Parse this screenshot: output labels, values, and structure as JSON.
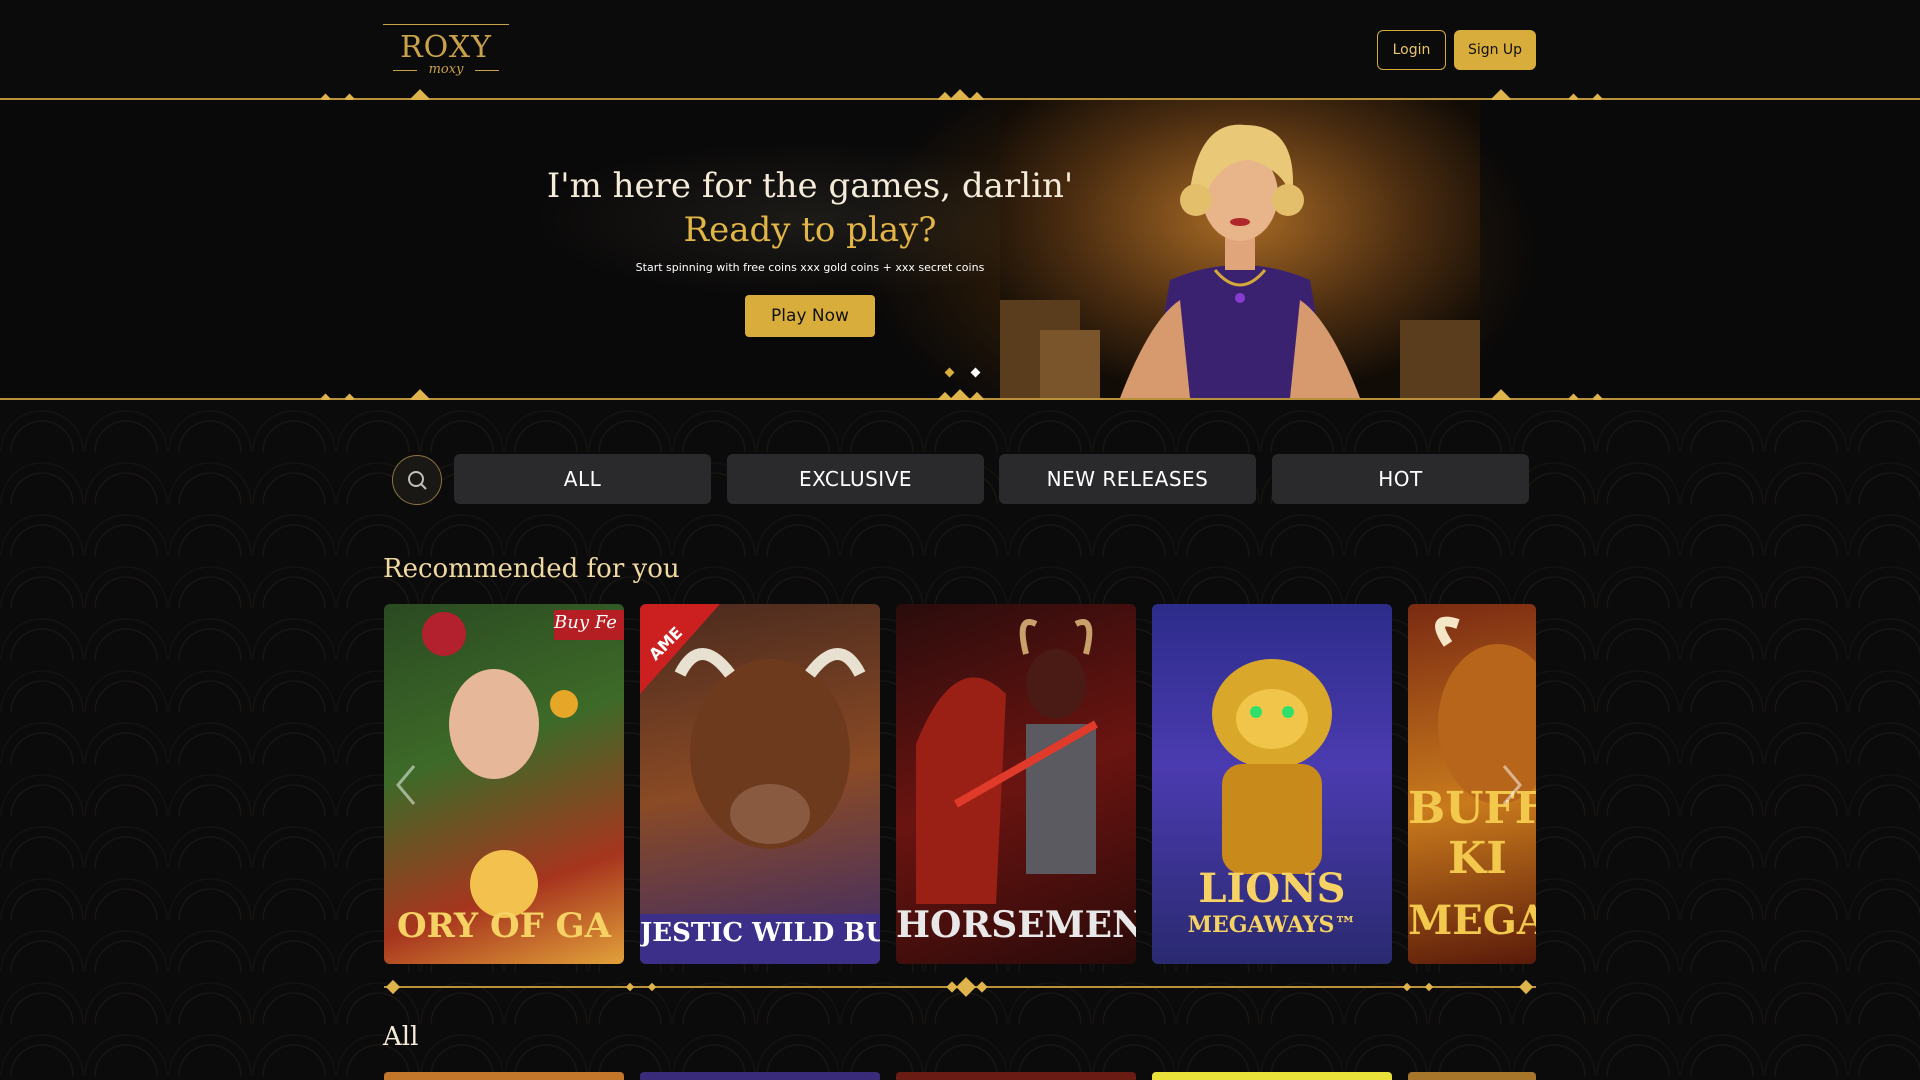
{
  "brand": {
    "name": "ROXY",
    "tagline": "moxy"
  },
  "header": {
    "login_label": "Login",
    "signup_label": "Sign Up"
  },
  "hero": {
    "title": "I'm here for the games, darlin'",
    "subtitle": "Ready to play?",
    "description": "Start spinning with free coins xxx gold coins + xxx secret coins",
    "cta_label": "Play Now",
    "slides_total": 2,
    "active_slide": 2
  },
  "filters": {
    "search_icon": "search-icon",
    "tabs": [
      {
        "label": "ALL"
      },
      {
        "label": "EXCLUSIVE"
      },
      {
        "label": "NEW RELEASES"
      },
      {
        "label": "HOT"
      }
    ]
  },
  "recommended": {
    "title": "Recommended for you",
    "games": [
      {
        "label": "ORY OF GA",
        "badge": "Buy Fe",
        "colors": [
          "#2a4a22",
          "#a7351e",
          "#e2a13a"
        ]
      },
      {
        "label": "JESTIC WILD BUFFA",
        "badge": "AME",
        "colors": [
          "#5a2a18",
          "#9a5530",
          "#3a3a8a"
        ]
      },
      {
        "label": "HORSEMEN I",
        "colors": [
          "#3a0d0d",
          "#8a1c16",
          "#c0392b"
        ]
      },
      {
        "label": "LIONS",
        "sublabel": "MEGAWAYS™",
        "colors": [
          "#2a2a8a",
          "#4b3bb0",
          "#d9a72a"
        ]
      },
      {
        "label": "BUFF",
        "sublabel": "KI",
        "sublabel2": "MEGA",
        "colors": [
          "#7a2a12",
          "#c97a1c",
          "#f2c94c"
        ]
      }
    ]
  },
  "all_section": {
    "title": "All"
  },
  "colors": {
    "gold": "#d9ad3c",
    "gold_line": "#b8913a",
    "bg": "#0b0b0c",
    "tab_bg": "#2a2a2c"
  }
}
